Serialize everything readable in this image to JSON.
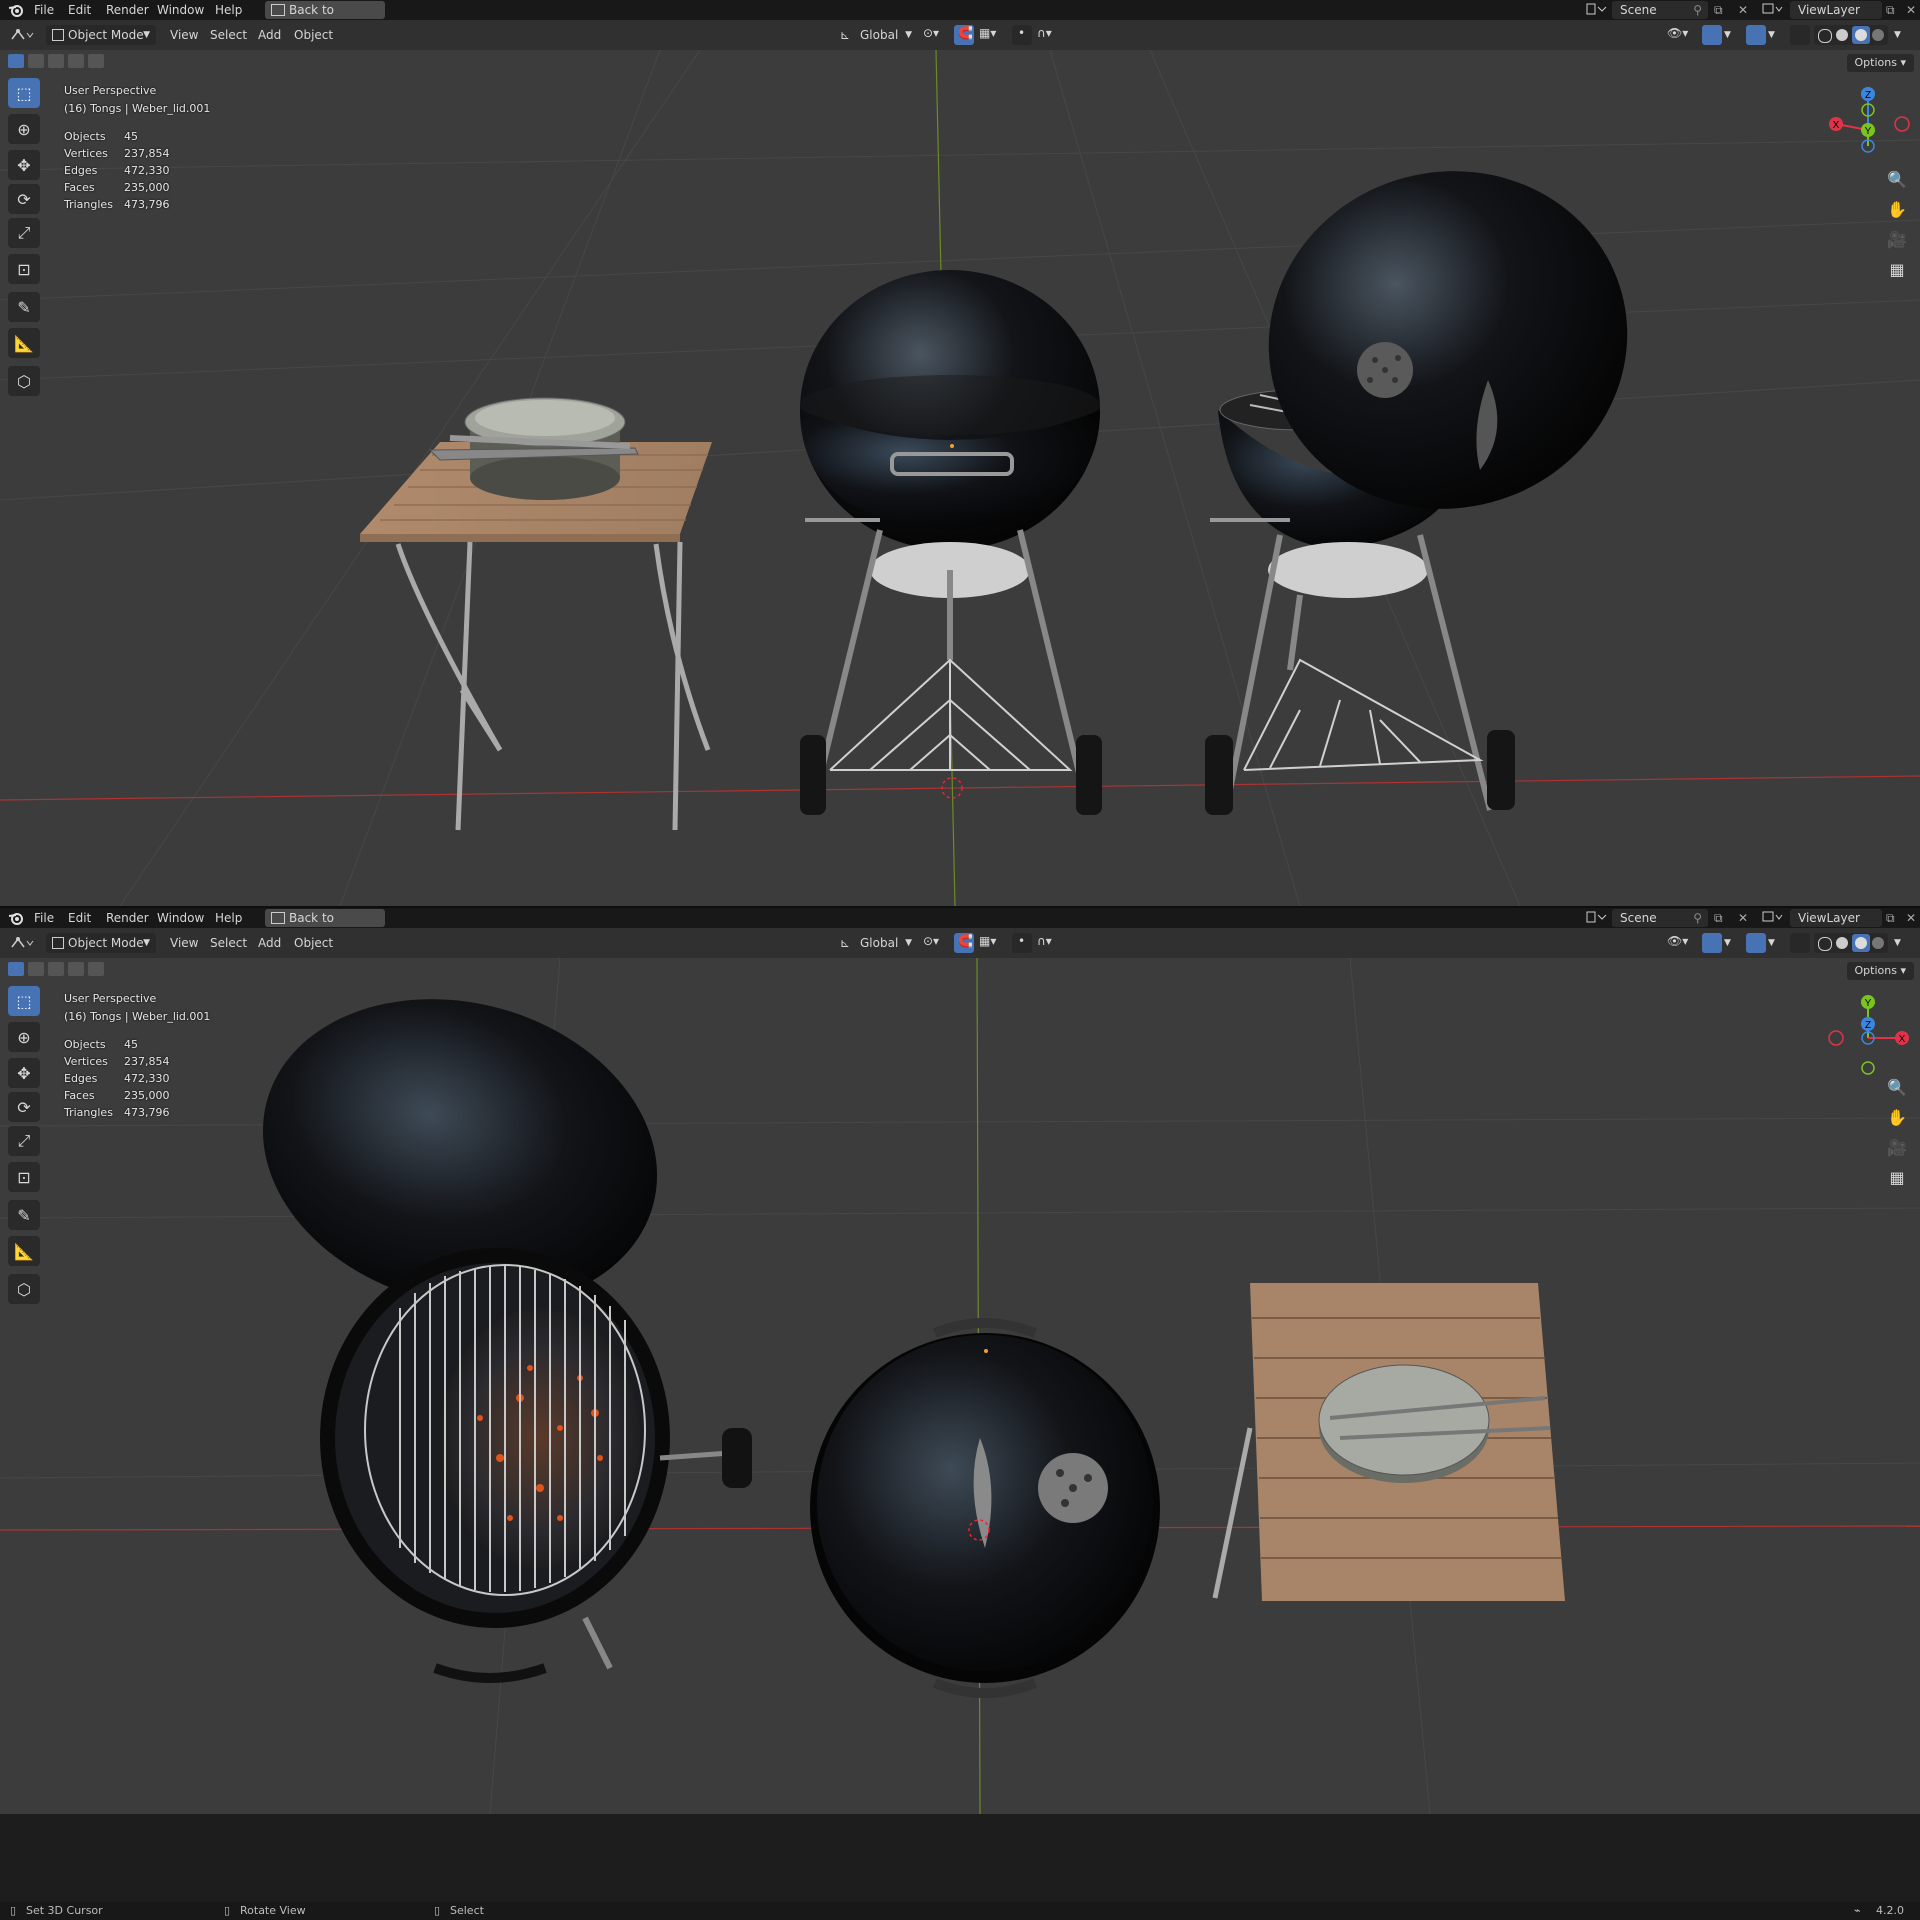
{
  "topbar": {
    "menu": [
      "File",
      "Edit",
      "Render",
      "Window",
      "Help"
    ],
    "back_button": "Back to Previous",
    "scene": "Scene",
    "view_layer": "ViewLayer"
  },
  "header": {
    "mode": "Object Mode",
    "menus": [
      "View",
      "Select",
      "Add",
      "Object"
    ],
    "orientation": "Global",
    "options": "Options"
  },
  "viewport": {
    "perspective": "User Perspective",
    "active_object": "(16) Tongs | Weber_lid.001",
    "stats": [
      {
        "label": "Objects",
        "value": "45"
      },
      {
        "label": "Vertices",
        "value": "237,854"
      },
      {
        "label": "Edges",
        "value": "472,330"
      },
      {
        "label": "Faces",
        "value": "235,000"
      },
      {
        "label": "Triangles",
        "value": "473,796"
      }
    ]
  },
  "gizmo": {
    "top": {
      "z": "Z",
      "y": "Y",
      "x": "X"
    },
    "bottom": {
      "z": "Z",
      "y": "Y",
      "x": "X"
    }
  },
  "statusbar": {
    "left": "Set 3D Cursor",
    "middle": "Rotate View",
    "right": "Select",
    "version": "4.2.0"
  },
  "colors": {
    "accent": "#4772b3",
    "x_axis": "#e0334a",
    "y_axis": "#7bc41f",
    "z_axis": "#3b87e0",
    "viewport_bg": "#3c3c3c"
  }
}
